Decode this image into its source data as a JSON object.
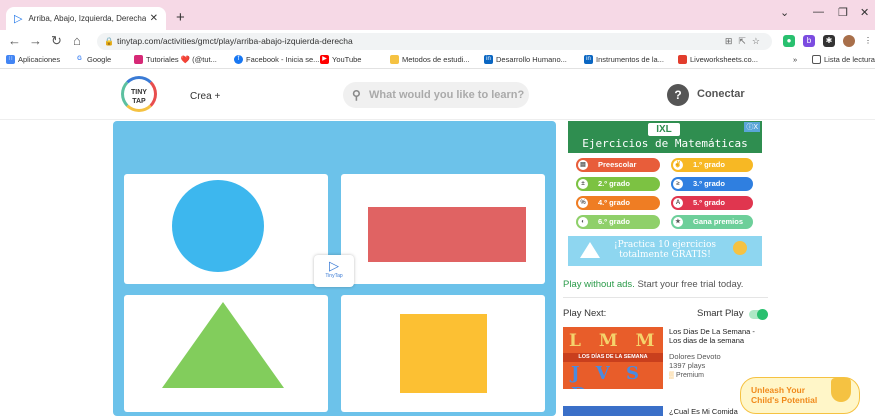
{
  "browser": {
    "tab_title": "Arriba, Abajo, Izquierda, Derecha",
    "url": "tinytap.com/activities/gmct/play/arriba-abajo-izquierda-derecha",
    "bookmarks": [
      "Aplicaciones",
      "Google",
      "Tutoriales ❤️ (@tut...",
      "Facebook - Inicia se...",
      "YouTube",
      "Metodos de estudi...",
      "Desarrollo Humano...",
      "Instrumentos de la...",
      "Liveworksheets.co...",
      "Lista de lectura"
    ]
  },
  "header": {
    "logo_text": "TINY TAP",
    "crea_label": "Crea +",
    "search_placeholder": "What would you like to learn?",
    "help_label": "?",
    "conectar_label": "Conectar"
  },
  "game": {
    "badge_label": "TinyTap",
    "shapes": [
      "circle",
      "rectangle",
      "triangle",
      "square"
    ],
    "colors": {
      "background": "#6cc2ea",
      "circle": "#3db7ee",
      "rectangle": "#e06363",
      "triangle": "#82cd5c",
      "square": "#fcc033"
    }
  },
  "ad": {
    "logo": "IXL",
    "title": "Ejercicios de Matemáticas",
    "close": "ⓘX",
    "buttons": [
      {
        "label": "Preescolar",
        "icon": "▤",
        "color": "#e85d3a"
      },
      {
        "label": "1.º grado",
        "icon": "✌",
        "color": "#f7b824"
      },
      {
        "label": "2.º grado",
        "icon": "±",
        "color": "#7cc242"
      },
      {
        "label": "3.º grado",
        "icon": "≥",
        "color": "#2f7fe0"
      },
      {
        "label": "4.º grado",
        "icon": "%",
        "color": "#ef7d23"
      },
      {
        "label": "5.º grado",
        "icon": "A",
        "color": "#e0364f"
      },
      {
        "label": "6.º grado",
        "icon": "◐",
        "color": "#8fd06a"
      },
      {
        "label": "Gana premios",
        "icon": "★",
        "color": "#6dcf9a"
      }
    ],
    "footer_line1": "¡Practica 10 ejercicios",
    "footer_line2": "totalmente GRATIS!"
  },
  "sidebar": {
    "noads_green": "Play without ads.",
    "noads_rest": " Start your free trial today.",
    "play_next_label": "Play Next:",
    "smart_play_label": "Smart Play",
    "smart_play_on": true,
    "items": [
      {
        "thumb_top": "L M M",
        "thumb_band": "LOS DÍAS DE LA SEMANA",
        "thumb_bottom": "J V S D",
        "title": "Los Dias De La Semana - Los dias de la semana",
        "author": "Dolores Devoto",
        "plays": "1397 plays",
        "premium": "Premium"
      },
      {
        "title": "¿Cual Es Mi Comida"
      }
    ],
    "promo_line1": "Unleash Your",
    "promo_line2": "Child's Potential"
  }
}
